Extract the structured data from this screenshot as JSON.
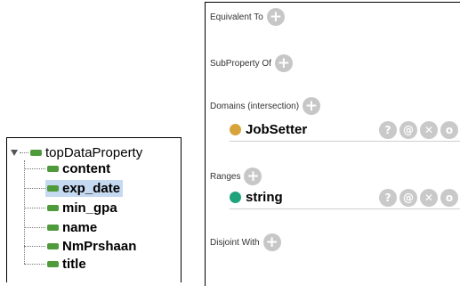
{
  "tree": {
    "root_label": "topDataProperty",
    "children": [
      {
        "label": "content"
      },
      {
        "label": "exp_date",
        "selected": true
      },
      {
        "label": "min_gpa"
      },
      {
        "label": "name"
      },
      {
        "label": "NmPrshaan"
      },
      {
        "label": "title"
      }
    ]
  },
  "description": {
    "equivalent_to": {
      "title": "Equivalent To"
    },
    "subproperty_of": {
      "title": "SubProperty Of"
    },
    "domains": {
      "title": "Domains (intersection)",
      "entries": [
        {
          "label": "JobSetter",
          "color": "#d8a33a"
        }
      ]
    },
    "ranges": {
      "title": "Ranges",
      "entries": [
        {
          "label": "string",
          "color": "#1ea37a"
        }
      ]
    },
    "disjoint_with": {
      "title": "Disjoint With"
    },
    "icons": {
      "add": "+",
      "help": "?",
      "annotate": "@",
      "delete": "✕",
      "edit": "o"
    },
    "colors": {
      "add_button": "#c7c7c7",
      "selection": "#c5d9f1",
      "property_icon": "#4f9a3b"
    }
  }
}
